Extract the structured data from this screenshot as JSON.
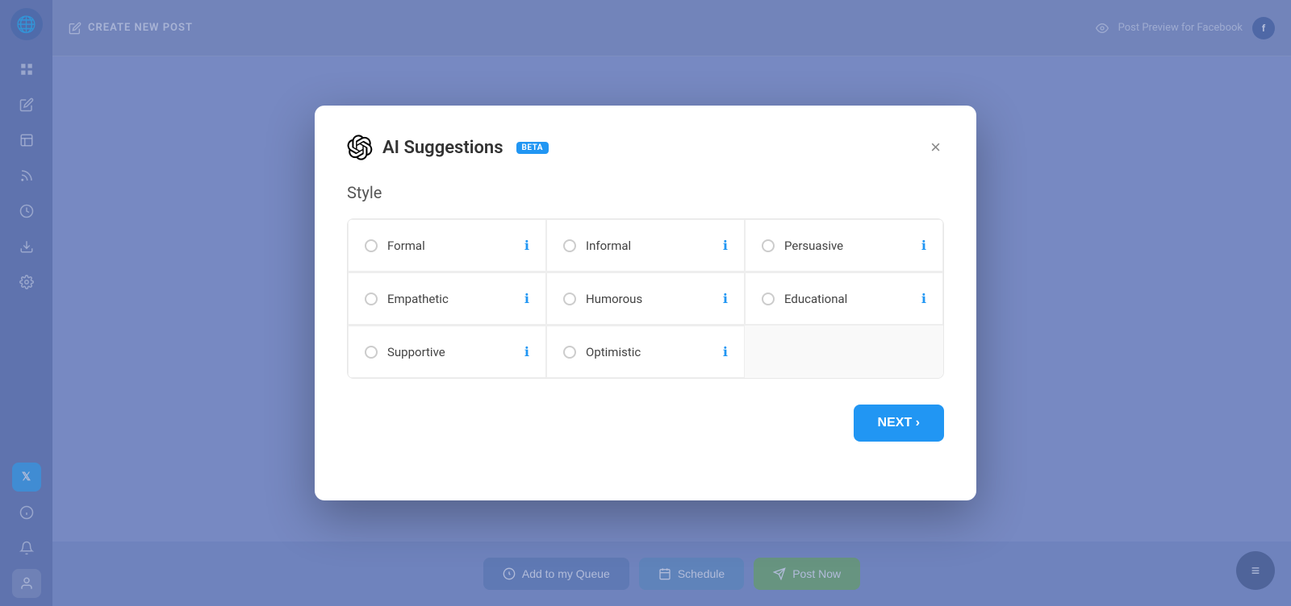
{
  "sidebar": {
    "logo_icon": "🌐",
    "items": [
      {
        "id": "dashboard",
        "icon": "⊞",
        "label": "Dashboard"
      },
      {
        "id": "compose",
        "icon": "✏️",
        "label": "Compose"
      },
      {
        "id": "posts",
        "icon": "📄",
        "label": "Posts"
      },
      {
        "id": "feed",
        "icon": "📡",
        "label": "Feed"
      },
      {
        "id": "schedule",
        "icon": "🕐",
        "label": "Schedule"
      },
      {
        "id": "download",
        "icon": "⬇",
        "label": "Download"
      },
      {
        "id": "settings",
        "icon": "⚙",
        "label": "Settings"
      }
    ],
    "bottom_items": [
      {
        "id": "twitter",
        "icon": "🐦",
        "label": "Twitter"
      },
      {
        "id": "info",
        "icon": "ℹ",
        "label": "Info"
      },
      {
        "id": "bell",
        "icon": "🔔",
        "label": "Notifications"
      },
      {
        "id": "avatar",
        "icon": "👤",
        "label": "Profile"
      }
    ]
  },
  "header": {
    "title": "CREATE NEW POST",
    "preview_label": "Post Preview for Facebook"
  },
  "modal": {
    "title": "AI Suggestions",
    "beta_label": "BETA",
    "section_title": "Style",
    "close_icon": "×",
    "style_options": [
      {
        "id": "formal",
        "label": "Formal",
        "has_info": true
      },
      {
        "id": "informal",
        "label": "Informal",
        "has_info": true
      },
      {
        "id": "persuasive",
        "label": "Persuasive",
        "has_info": true
      },
      {
        "id": "empathetic",
        "label": "Empathetic",
        "has_info": true
      },
      {
        "id": "humorous",
        "label": "Humorous",
        "has_info": true
      },
      {
        "id": "educational",
        "label": "Educational",
        "has_info": true
      },
      {
        "id": "supportive",
        "label": "Supportive",
        "has_info": true
      },
      {
        "id": "optimistic",
        "label": "Optimistic",
        "has_info": true
      }
    ],
    "next_button": "NEXT ›"
  },
  "bottom_bar": {
    "queue_label": "Add to my Queue",
    "schedule_label": "Schedule",
    "post_label": "Post Now"
  },
  "chat_button_icon": "≡"
}
